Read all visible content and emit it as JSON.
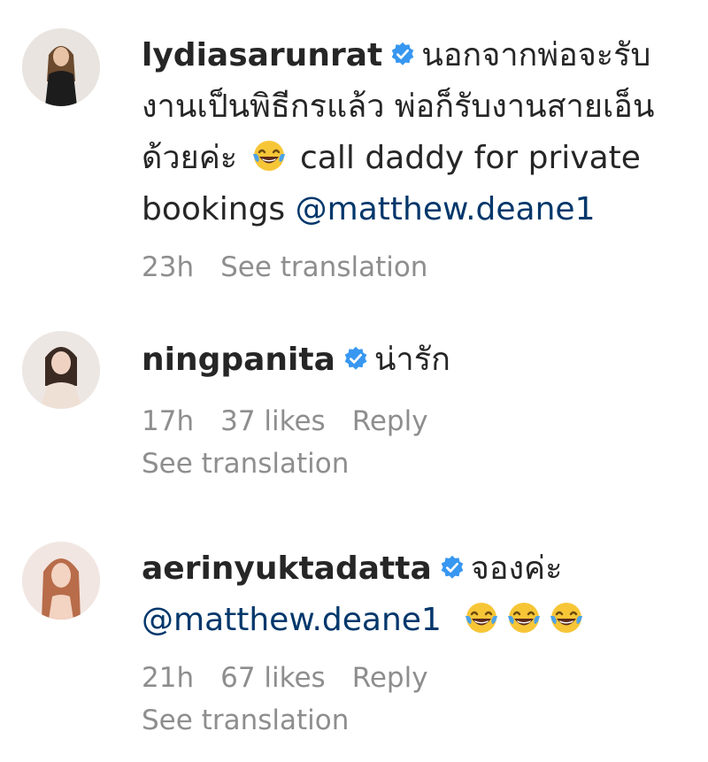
{
  "comments": [
    {
      "username": "lydiasarunrat",
      "verified": true,
      "text_thai": "นอกจากพ่อจะรับงานเป็นพิธีกรแล้ว พ่อก็รับงานสายเอ็นด้วยค่ะ",
      "text_en": "call daddy for private bookings",
      "mention": "@matthew.deane1",
      "emoji": "face-with-tears-of-joy",
      "time": "23h",
      "see_translation": "See translation"
    },
    {
      "username": "ningpanita",
      "verified": true,
      "text_thai": "น่ารัก",
      "time": "17h",
      "likes": "37 likes",
      "reply": "Reply",
      "see_translation": "See translation"
    },
    {
      "username": "aerinyuktadatta",
      "verified": true,
      "text_thai": "จองค่ะ",
      "mention": "@matthew.deane1",
      "emoji": "face-with-tears-of-joy",
      "time": "21h",
      "likes": "67 likes",
      "reply": "Reply",
      "see_translation": "See translation"
    }
  ],
  "colors": {
    "text": "#262626",
    "meta": "#8e8e8e",
    "mention": "#00376b",
    "verified": "#3897f0"
  }
}
